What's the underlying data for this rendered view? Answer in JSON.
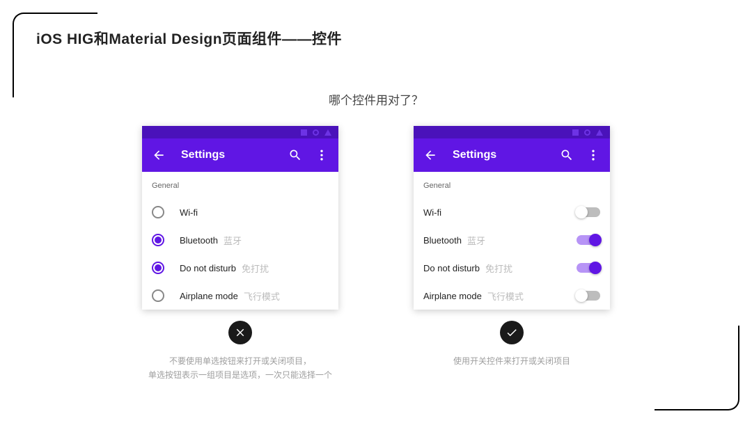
{
  "title": "iOS HIG和Material Design页面组件——控件",
  "question": "哪个控件用对了？",
  "appbar": {
    "title": "Settings"
  },
  "section": {
    "general": "General"
  },
  "left": {
    "items": [
      {
        "label": "Wi-fi",
        "anno": "",
        "on": false
      },
      {
        "label": "Bluetooth",
        "anno": "蓝牙",
        "on": true
      },
      {
        "label": "Do not disturb",
        "anno": "免打扰",
        "on": true
      },
      {
        "label": "Airplane mode",
        "anno": "飞行模式",
        "on": false
      }
    ],
    "caption1": "不要使用单选按钮来打开或关闭项目，",
    "caption2": "单选按钮表示一组项目是选项，一次只能选择一个"
  },
  "right": {
    "items": [
      {
        "label": "Wi-fi",
        "anno": "",
        "on": false
      },
      {
        "label": "Bluetooth",
        "anno": "蓝牙",
        "on": true
      },
      {
        "label": "Do not disturb",
        "anno": "免打扰",
        "on": true
      },
      {
        "label": "Airplane mode",
        "anno": "飞行模式",
        "on": false
      }
    ],
    "caption1": "使用开关控件来打开或关闭项目"
  }
}
